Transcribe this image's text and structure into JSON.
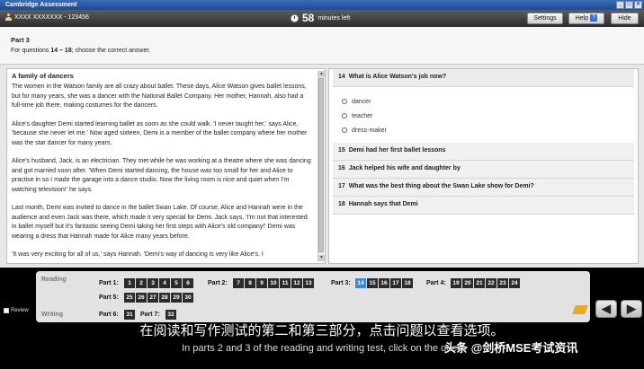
{
  "window": {
    "title": "Cambridge Assessment"
  },
  "infobar": {
    "candidate": "XXXX XXXXXXX - 123456",
    "timer_value": "58",
    "timer_unit": "minutes left",
    "settings_label": "Settings",
    "help_label": "Help",
    "help_icon": "?",
    "hide_label": "Hide"
  },
  "header": {
    "part": "Part 3",
    "instruction_pre": "For questions ",
    "instruction_range": "14 – 18",
    "instruction_post": "; choose the correct answer."
  },
  "reading": {
    "title": "A family of dancers",
    "paragraphs": [
      "The women in the Watson family are all crazy about ballet. These days, Alice Watson gives ballet lessons, but for many years, she was a dancer with the National Ballet Company. Her mother, Hannah, also had a full-time job there, making costumes for the dancers.",
      "Alice's daughter Demi started learning ballet as soon as she could walk. 'I never taught her,' says Alice, 'because she never let me.' Now aged sixteen, Demi is a member of the ballet company where her mother was the star dancer for many years.",
      "Alice's husband, Jack, is an electrician. They met while he was working at a theatre where she was dancing and got married soon after. 'When Demi started dancing, the house was too small for her and Alice to practise in so I made the garage into a dance studio. Now the living room is nice and quiet when I'm watching television!' he says.",
      "Last month, Demi was invited to dance in the ballet Swan Lake. Of course, Alice and Hannah were in the audience and even Jack was there, which made it very special for Demi. Jack says, 'I'm not that interested in ballet myself but it's fantastic seeing Demi taking her first steps with Alice's old company!' Demi was wearing a dress that Hannah made for Alice many years before.",
      "'It was very exciting for all of us,' says Hannah. 'Demi's way of dancing is very like Alice's. I"
    ]
  },
  "questions": [
    {
      "num": "14",
      "text": "What is Alice Watson's job now?",
      "options": [
        "dancer",
        "teacher",
        "dress-maker"
      ]
    },
    {
      "num": "15",
      "text": "Demi had her first ballet lessons"
    },
    {
      "num": "16",
      "text": "Jack helped his wife and daughter by"
    },
    {
      "num": "17",
      "text": "What was the best thing about the Swan Lake show for Demi?"
    },
    {
      "num": "18",
      "text": "Hannah says that Demi"
    }
  ],
  "nav": {
    "reading_label": "Reading",
    "writing_label": "Writing",
    "review_label": "Review",
    "part1": "Part 1:",
    "part2": "Part 2:",
    "part3": "Part 3:",
    "part4": "Part 4:",
    "part5": "Part 5:",
    "part6": "Part 6:",
    "part7": "Part 7:",
    "p1_nums": [
      "1",
      "2",
      "3",
      "4",
      "5",
      "6"
    ],
    "p2_nums": [
      "7",
      "8",
      "9",
      "10",
      "11",
      "12",
      "13"
    ],
    "p3_nums": [
      "14",
      "15",
      "16",
      "17",
      "18"
    ],
    "p4_nums": [
      "19",
      "20",
      "21",
      "22",
      "23",
      "24"
    ],
    "p5_nums": [
      "25",
      "26",
      "27",
      "28",
      "29",
      "30"
    ],
    "p6_nums": [
      "31"
    ],
    "p7_nums": [
      "32"
    ],
    "selected": "14",
    "prev_arrow": "◀",
    "next_arrow": "▶"
  },
  "subtitles": {
    "cn": "在阅读和写作测试的第二和第三部分，点击问题以查看选项。",
    "en": "In parts 2 and 3 of the reading and writing test, click on the ques"
  },
  "watermark": "头条 @剑桥MSE考试资讯"
}
